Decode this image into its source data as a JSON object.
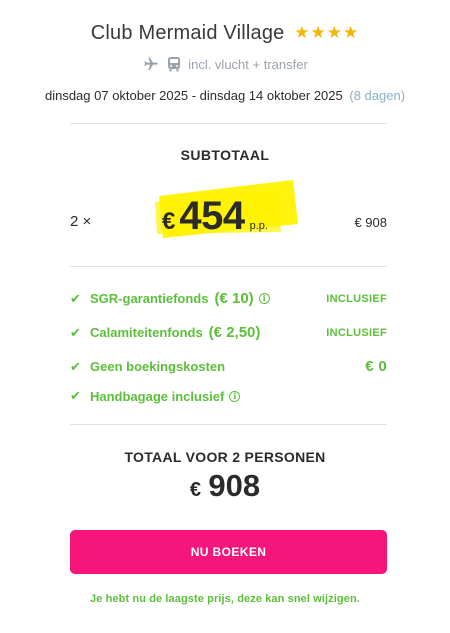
{
  "hotel": {
    "name": "Club Mermaid Village",
    "stars": "★★★★",
    "stars_count": 4,
    "star_color": "#f2b705"
  },
  "travel": {
    "icons": [
      "airplane-icon",
      "bus-icon"
    ],
    "text": "incl. vlucht + transfer"
  },
  "dates": {
    "range": "dinsdag 07 oktober 2025 - dinsdag 14 oktober 2025",
    "duration": "(8 dagen)"
  },
  "subtotal": {
    "label": "SUBTOTAAL",
    "quantity": "2 ×",
    "currency": "€",
    "price": "454",
    "per_person": "p.p.",
    "line_total": "€ 908",
    "highlight_color": "#fff200"
  },
  "features": [
    {
      "label": "SGR-garantiefonds",
      "amount": "(€ 10)",
      "info": true,
      "status": "INCLUSIEF"
    },
    {
      "label": "Calamiteitenfonds",
      "amount": "(€ 2,50)",
      "info": false,
      "status": "INCLUSIEF"
    },
    {
      "label": "Geen boekingskosten",
      "amount": "",
      "info": false,
      "status": "€ 0"
    },
    {
      "label": "Handbagage inclusief",
      "amount": "",
      "info": true,
      "status": ""
    }
  ],
  "total": {
    "label": "TOTAAL VOOR 2 PERSONEN",
    "currency": "€",
    "amount": "908"
  },
  "book_button": {
    "label": "NU BOEKEN",
    "color": "#f5157b"
  },
  "footer_note": "Je hebt nu de laagste prijs, deze kan snel wijzigen.",
  "colors": {
    "accent_green": "#5cbf3a",
    "muted_blue": "#8ab0c4",
    "icon_gray": "#9aa2aa"
  }
}
